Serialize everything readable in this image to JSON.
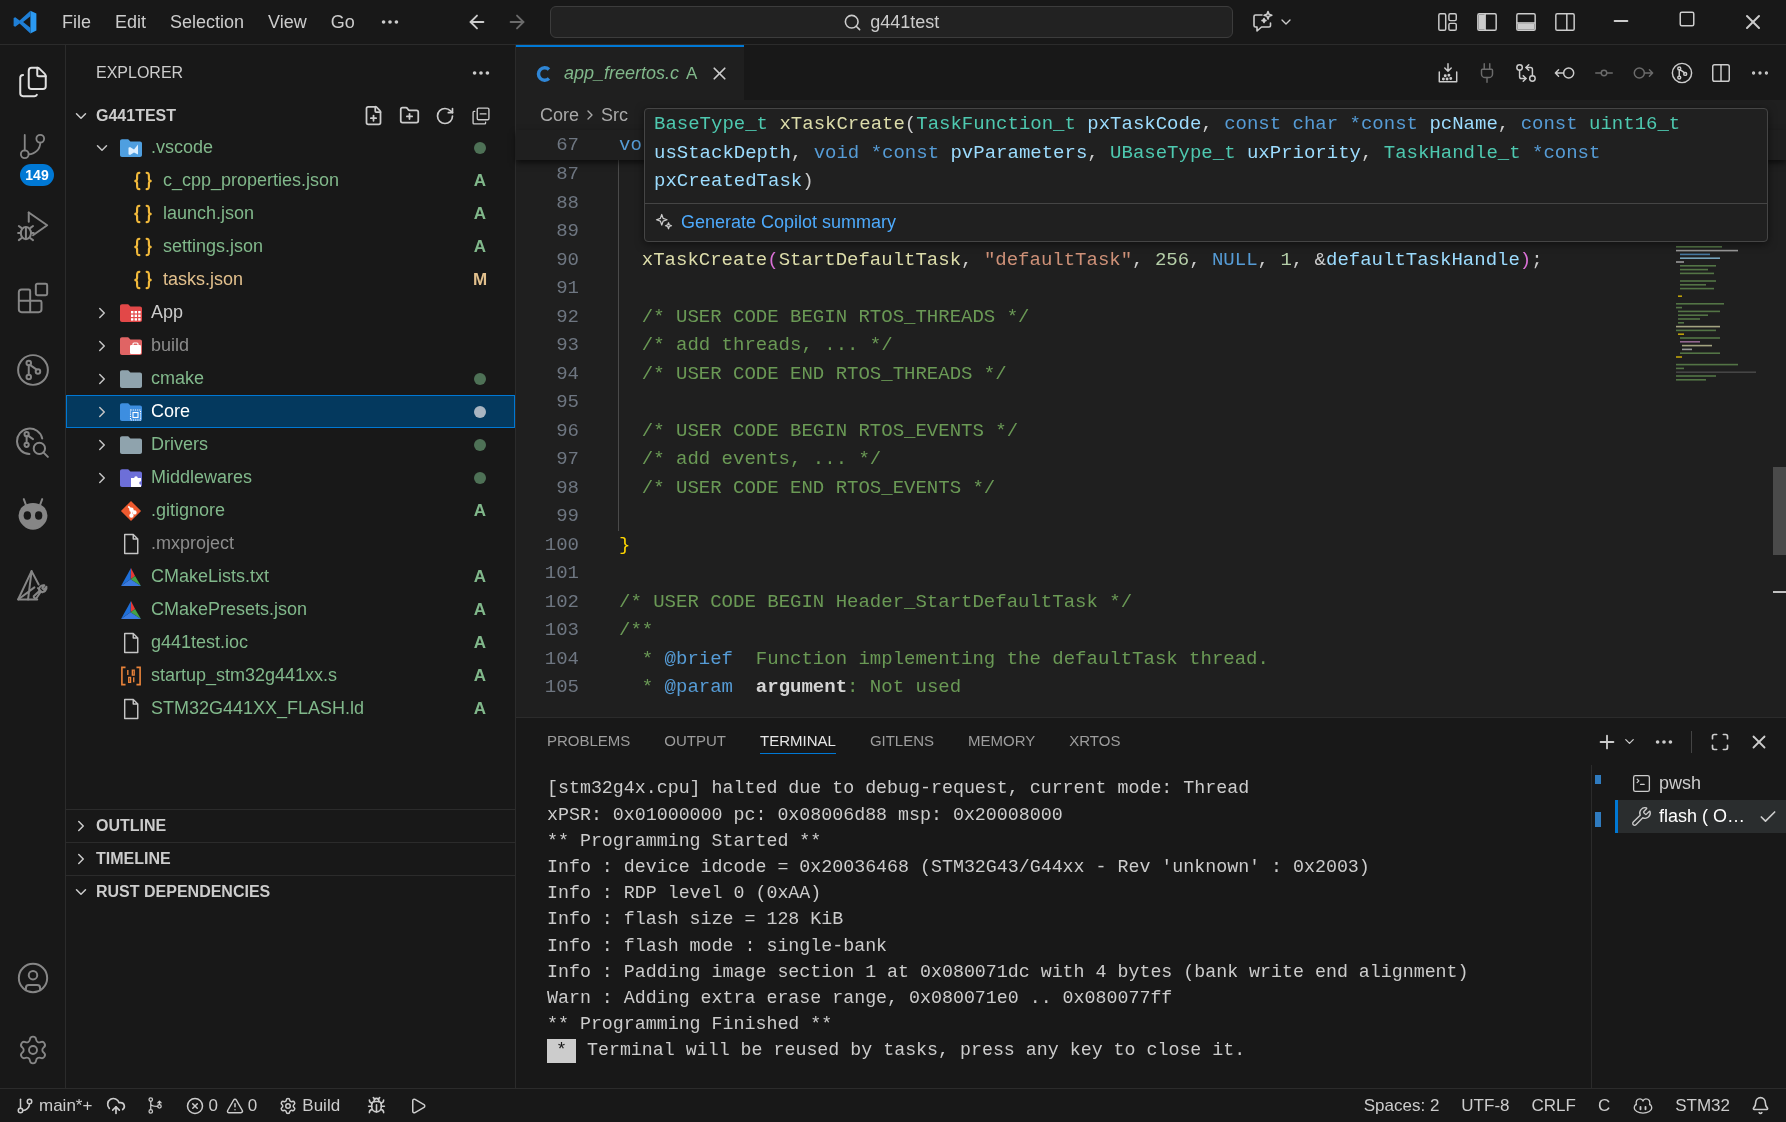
{
  "title_bar": {
    "menu": [
      "File",
      "Edit",
      "Selection",
      "View",
      "Go"
    ],
    "nav": [
      {
        "disabled": false
      },
      {
        "disabled": true
      }
    ],
    "command_center": "g441test",
    "layout_toggles": [
      {
        "on": true
      },
      {
        "on": true
      },
      {
        "on": false
      }
    ]
  },
  "activity_bar": {
    "items": [
      {
        "selected": true
      },
      {
        "selected": false,
        "badge": "149"
      },
      {
        "selected": false
      },
      {
        "selected": false
      },
      {
        "selected": false
      },
      {
        "selected": false
      },
      {
        "selected": false
      },
      {
        "selected": false
      }
    ]
  },
  "sidebar": {
    "title": "EXPLORER",
    "root": {
      "label": "G441TEST",
      "expanded": true
    },
    "tree": [
      {
        "label": ".vscode",
        "kind": "folder_vscode",
        "color": "#81b88b",
        "changes": true,
        "expanded": true,
        "selected": false,
        "children": [
          {
            "label": "c_cpp_properties.json",
            "kind": "json",
            "color": "#81b88b",
            "status": "A",
            "selected": false
          },
          {
            "label": "launch.json",
            "kind": "json",
            "color": "#81b88b",
            "status": "A",
            "selected": false
          },
          {
            "label": "settings.json",
            "kind": "json",
            "color": "#81b88b",
            "status": "A",
            "selected": false
          },
          {
            "label": "tasks.json",
            "kind": "json",
            "color": "#e2c08d",
            "status": "M",
            "selected": false
          }
        ]
      },
      {
        "label": "App",
        "kind": "folder_app",
        "color": "#cccccc",
        "changes": false,
        "expanded": false,
        "selected": false
      },
      {
        "label": "build",
        "kind": "folder_build",
        "color": "#8c8c8c",
        "changes": false,
        "expanded": false,
        "selected": false
      },
      {
        "label": "cmake",
        "kind": "folder",
        "color": "#81b88b",
        "changes": true,
        "expanded": false,
        "selected": false
      },
      {
        "label": "Core",
        "kind": "folder_core",
        "color": "#ffffff",
        "changes": true,
        "expanded": false,
        "selected": true
      },
      {
        "label": "Drivers",
        "kind": "folder",
        "color": "#81b88b",
        "changes": true,
        "expanded": false,
        "selected": false
      },
      {
        "label": "Middlewares",
        "kind": "folder_plugin",
        "color": "#81b88b",
        "changes": true,
        "expanded": false,
        "selected": false
      },
      {
        "label": ".gitignore",
        "kind": "git",
        "color": "#81b88b",
        "status": "A",
        "selected": false
      },
      {
        "label": ".mxproject",
        "kind": "plain",
        "color": "#8c8c8c",
        "selected": false
      },
      {
        "label": "CMakeLists.txt",
        "kind": "cmake",
        "color": "#81b88b",
        "status": "A",
        "selected": false
      },
      {
        "label": "CMakePresets.json",
        "kind": "cmake",
        "color": "#81b88b",
        "status": "A",
        "selected": false
      },
      {
        "label": "g441test.ioc",
        "kind": "plain",
        "color": "#81b88b",
        "status": "A",
        "selected": false
      },
      {
        "label": "startup_stm32g441xx.s",
        "kind": "binary",
        "color": "#81b88b",
        "status": "A",
        "selected": false
      },
      {
        "label": "STM32G441XX_FLASH.ld",
        "kind": "plain",
        "color": "#81b88b",
        "status": "A",
        "selected": false
      }
    ],
    "sections": [
      {
        "title": "OUTLINE",
        "expanded": false
      },
      {
        "title": "TIMELINE",
        "expanded": false
      },
      {
        "title": "RUST DEPENDENCIES",
        "expanded": true
      }
    ]
  },
  "editor": {
    "tab": {
      "label": "app_freertos.c",
      "status": "A",
      "color": "#81b88b",
      "selected": true,
      "preview": true
    },
    "actions": [
      {
        "disabled": false
      },
      {
        "disabled": true
      },
      {
        "disabled": false
      },
      {
        "disabled": false
      },
      {
        "disabled": true
      },
      {
        "disabled": true
      },
      {
        "disabled": false
      },
      {
        "disabled": false
      },
      {
        "disabled": false
      }
    ],
    "breadcrumb": [
      "Core",
      "Src"
    ],
    "sticky_line": {
      "number": "67",
      "tokens": [
        {
          "kind": "keyword",
          "text": "vo"
        }
      ]
    },
    "lines": [
      {
        "number": "87",
        "guide": true
      },
      {
        "number": "88",
        "guide": true
      },
      {
        "number": "89",
        "guide": true
      },
      {
        "number": "90",
        "guide": true,
        "tokens": [
          {
            "kind": "function",
            "text": "  xTaskCreate"
          },
          {
            "kind": "bracket_inner",
            "text": "("
          },
          {
            "kind": "function",
            "text": "StartDefaultTask"
          },
          {
            "kind": "plain",
            "text": ", "
          },
          {
            "kind": "string",
            "text": "\"defaultTask\""
          },
          {
            "kind": "plain",
            "text": ", "
          },
          {
            "kind": "number",
            "text": "256"
          },
          {
            "kind": "plain",
            "text": ", "
          },
          {
            "kind": "keyword",
            "text": "NULL"
          },
          {
            "kind": "plain",
            "text": ", "
          },
          {
            "kind": "number",
            "text": "1"
          },
          {
            "kind": "plain",
            "text": ", &"
          },
          {
            "kind": "variable",
            "text": "defaultTaskHandle"
          },
          {
            "kind": "bracket_inner",
            "text": ")"
          },
          {
            "kind": "plain",
            "text": ";"
          }
        ]
      },
      {
        "number": "91",
        "guide": true
      },
      {
        "number": "92",
        "guide": true,
        "tokens": [
          {
            "kind": "comment",
            "text": "  /* USER CODE BEGIN RTOS_THREADS */"
          }
        ]
      },
      {
        "number": "93",
        "guide": true,
        "tokens": [
          {
            "kind": "comment",
            "text": "  /* add threads, ... */"
          }
        ]
      },
      {
        "number": "94",
        "guide": true,
        "tokens": [
          {
            "kind": "comment",
            "text": "  /* USER CODE END RTOS_THREADS */"
          }
        ]
      },
      {
        "number": "95",
        "guide": true
      },
      {
        "number": "96",
        "guide": true,
        "tokens": [
          {
            "kind": "comment",
            "text": "  /* USER CODE BEGIN RTOS_EVENTS */"
          }
        ]
      },
      {
        "number": "97",
        "guide": true,
        "tokens": [
          {
            "kind": "comment",
            "text": "  /* add events, ... */"
          }
        ]
      },
      {
        "number": "98",
        "guide": true,
        "tokens": [
          {
            "kind": "comment",
            "text": "  /* USER CODE END RTOS_EVENTS */"
          }
        ]
      },
      {
        "number": "99",
        "guide": true
      },
      {
        "number": "100",
        "guide": false,
        "tokens": [
          {
            "kind": "bracket_outer",
            "text": "}"
          }
        ]
      },
      {
        "number": "101",
        "guide": false
      },
      {
        "number": "102",
        "guide": false,
        "tokens": [
          {
            "kind": "comment",
            "text": "/* USER CODE BEGIN Header_StartDefaultTask */"
          }
        ]
      },
      {
        "number": "103",
        "guide": false,
        "tokens": [
          {
            "kind": "comment",
            "text": "/**"
          }
        ]
      },
      {
        "number": "104",
        "guide": false,
        "tokens": [
          {
            "kind": "comment",
            "text": "  * "
          },
          {
            "kind": "doc_tag",
            "text": "@brief"
          },
          {
            "kind": "comment",
            "text": "  Function implementing the defaultTask thread."
          }
        ]
      },
      {
        "number": "105",
        "guide": false,
        "tokens": [
          {
            "kind": "comment",
            "text": "  * "
          },
          {
            "kind": "doc_tag",
            "text": "@param"
          },
          {
            "kind": "doc_param",
            "text": "  argument"
          },
          {
            "kind": "comment",
            "text": ": Not used"
          }
        ]
      }
    ],
    "hover": {
      "signature": [
        {
          "tokens": [
            {
              "kind": "type",
              "text": "BaseType_t"
            },
            {
              "kind": "function",
              "text": " xTaskCreate"
            },
            {
              "kind": "plain",
              "text": "("
            },
            {
              "kind": "type",
              "text": "TaskFunction_t"
            },
            {
              "kind": "param",
              "text": " pxTaskCode"
            },
            {
              "kind": "plain",
              "text": ", "
            },
            {
              "kind": "keyword",
              "text": "const char *const"
            },
            {
              "kind": "param",
              "text": " pcName"
            },
            {
              "kind": "plain",
              "text": ", "
            },
            {
              "kind": "keyword",
              "text": "const"
            },
            {
              "kind": "type",
              "text": " uint16_t"
            }
          ]
        },
        {
          "tokens": [
            {
              "kind": "param",
              "text": "usStackDepth"
            },
            {
              "kind": "plain",
              "text": ", "
            },
            {
              "kind": "keyword",
              "text": "void *const"
            },
            {
              "kind": "param",
              "text": " pvParameters"
            },
            {
              "kind": "plain",
              "text": ", "
            },
            {
              "kind": "type",
              "text": "UBaseType_t"
            },
            {
              "kind": "param",
              "text": " uxPriority"
            },
            {
              "kind": "plain",
              "text": ", "
            },
            {
              "kind": "type",
              "text": "TaskHandle_t"
            },
            {
              "kind": "keyword",
              "text": " *const"
            }
          ]
        },
        {
          "tokens": [
            {
              "kind": "param",
              "text": "pxCreatedTask"
            },
            {
              "kind": "plain",
              "text": ")"
            }
          ]
        }
      ],
      "action": "Generate Copilot summary"
    }
  },
  "panel": {
    "tabs": [
      {
        "label": "PROBLEMS",
        "selected": false
      },
      {
        "label": "OUTPUT",
        "selected": false
      },
      {
        "label": "TERMINAL",
        "selected": true
      },
      {
        "label": "GITLENS",
        "selected": false
      },
      {
        "label": "MEMORY",
        "selected": false
      },
      {
        "label": "XRTOS",
        "selected": false
      }
    ],
    "terminal": {
      "lines": [
        {
          "kind": "output",
          "text": "[stm32g4x.cpu] halted due to debug-request, current mode: Thread"
        },
        {
          "kind": "output",
          "text": "xPSR: 0x01000000 pc: 0x08006d88 msp: 0x20008000"
        },
        {
          "kind": "output",
          "text": "** Programming Started **"
        },
        {
          "kind": "output",
          "text": "Info : device idcode = 0x20036468 (STM32G43/G44xx - Rev 'unknown' : 0x2003)"
        },
        {
          "kind": "output",
          "text": "Info : RDP level 0 (0xAA)"
        },
        {
          "kind": "output",
          "text": "Info : flash size = 128 KiB"
        },
        {
          "kind": "output",
          "text": "Info : flash mode : single-bank"
        },
        {
          "kind": "output",
          "text": "Info : Padding image section 1 at 0x080071dc with 4 bytes (bank write end alignment)"
        },
        {
          "kind": "output",
          "text": "Warn : Adding extra erase range, 0x080071e0 .. 0x080077ff"
        },
        {
          "kind": "output",
          "text": "** Programming Finished **"
        },
        {
          "kind": "notice",
          "marker": "*",
          "text": "Terminal will be reused by tasks, press any key to close it."
        }
      ]
    },
    "terminals": [
      {
        "label": "pwsh",
        "kind": "shell",
        "selected": false,
        "succeeded": false
      },
      {
        "label": "flash ( O…",
        "kind": "task",
        "selected": true,
        "succeeded": true
      }
    ]
  },
  "status_bar": {
    "branch": "main*+",
    "errors": "0",
    "warnings": "0",
    "build": "Build",
    "right": [
      "Spaces: 2",
      "UTF-8",
      "CRLF",
      "C"
    ],
    "target": "STM32"
  }
}
